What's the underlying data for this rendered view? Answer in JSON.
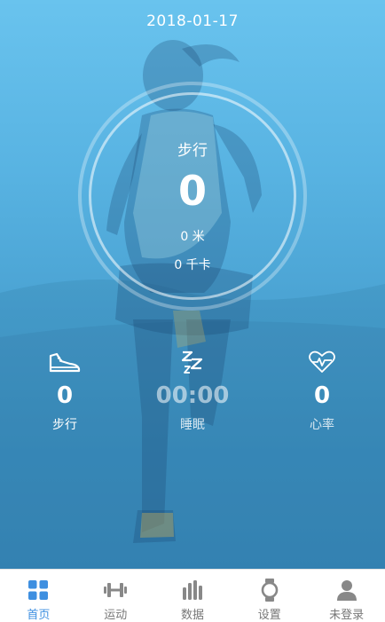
{
  "header": {
    "date": "2018-01-17"
  },
  "ring": {
    "title": "步行",
    "value": "0",
    "distance": "0 米",
    "calories": "0 千卡"
  },
  "stats": [
    {
      "icon": "shoe-icon",
      "value": "0",
      "label": "步行"
    },
    {
      "icon": "sleep-zzz-icon",
      "value": "00:00",
      "label": "睡眠"
    },
    {
      "icon": "heart-rate-icon",
      "value": "0",
      "label": "心率"
    }
  ],
  "tabs": [
    {
      "icon": "home-grid-icon",
      "label": "首页",
      "active": true
    },
    {
      "icon": "dumbbell-icon",
      "label": "运动",
      "active": false
    },
    {
      "icon": "bar-chart-icon",
      "label": "数据",
      "active": false
    },
    {
      "icon": "watch-icon",
      "label": "设置",
      "active": false
    },
    {
      "icon": "user-icon",
      "label": "未登录",
      "active": false
    }
  ],
  "colors": {
    "accent": "#3e8fe0",
    "background_top": "#69c3ee",
    "background_bottom": "#3a8dc0"
  }
}
